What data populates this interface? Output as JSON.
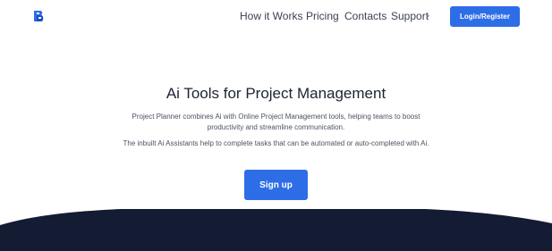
{
  "nav": {
    "logo_icon": "logo-icon",
    "links": [
      "How it Works",
      "Pricing",
      "Contacts",
      "Support"
    ],
    "support_caret": "▾",
    "login_label": "Login/Register"
  },
  "hero": {
    "title": "Ai Tools for Project Management",
    "paragraph_1": "Project Planner combines Ai with Online Project Management tools, helping teams to boost productivity and streamline communication.",
    "paragraph_2": "The inbuilt Ai Assistants help to complete tasks that can be automated or auto-completed with Ai.",
    "signup_label": "Sign up"
  },
  "colors": {
    "accent": "#2d6ee6",
    "wave": "#141c34"
  }
}
